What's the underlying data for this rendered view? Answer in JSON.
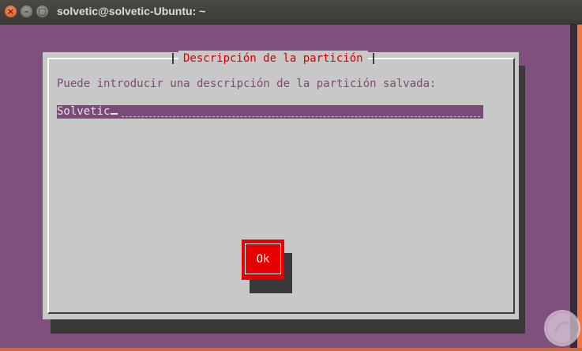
{
  "window": {
    "title": "solvetic@solvetic-Ubuntu: ~",
    "buttons": {
      "close": "×",
      "minimize": "–",
      "maximize": "▢"
    }
  },
  "dialog": {
    "title": "Descripción de la partición",
    "prompt": "Puede introducir una descripción de la partición salvada:",
    "input_value": "Solvetic",
    "ok_label": "Ok"
  },
  "colors": {
    "terminal_bg": "#7f4f7d",
    "dialog_bg": "#c8c8c8",
    "title_red": "#d40000",
    "button_red": "#e80000",
    "input_bg": "#7a4a78"
  },
  "icons": [
    "close-icon",
    "minimize-icon",
    "maximize-icon",
    "watermark-logo"
  ]
}
